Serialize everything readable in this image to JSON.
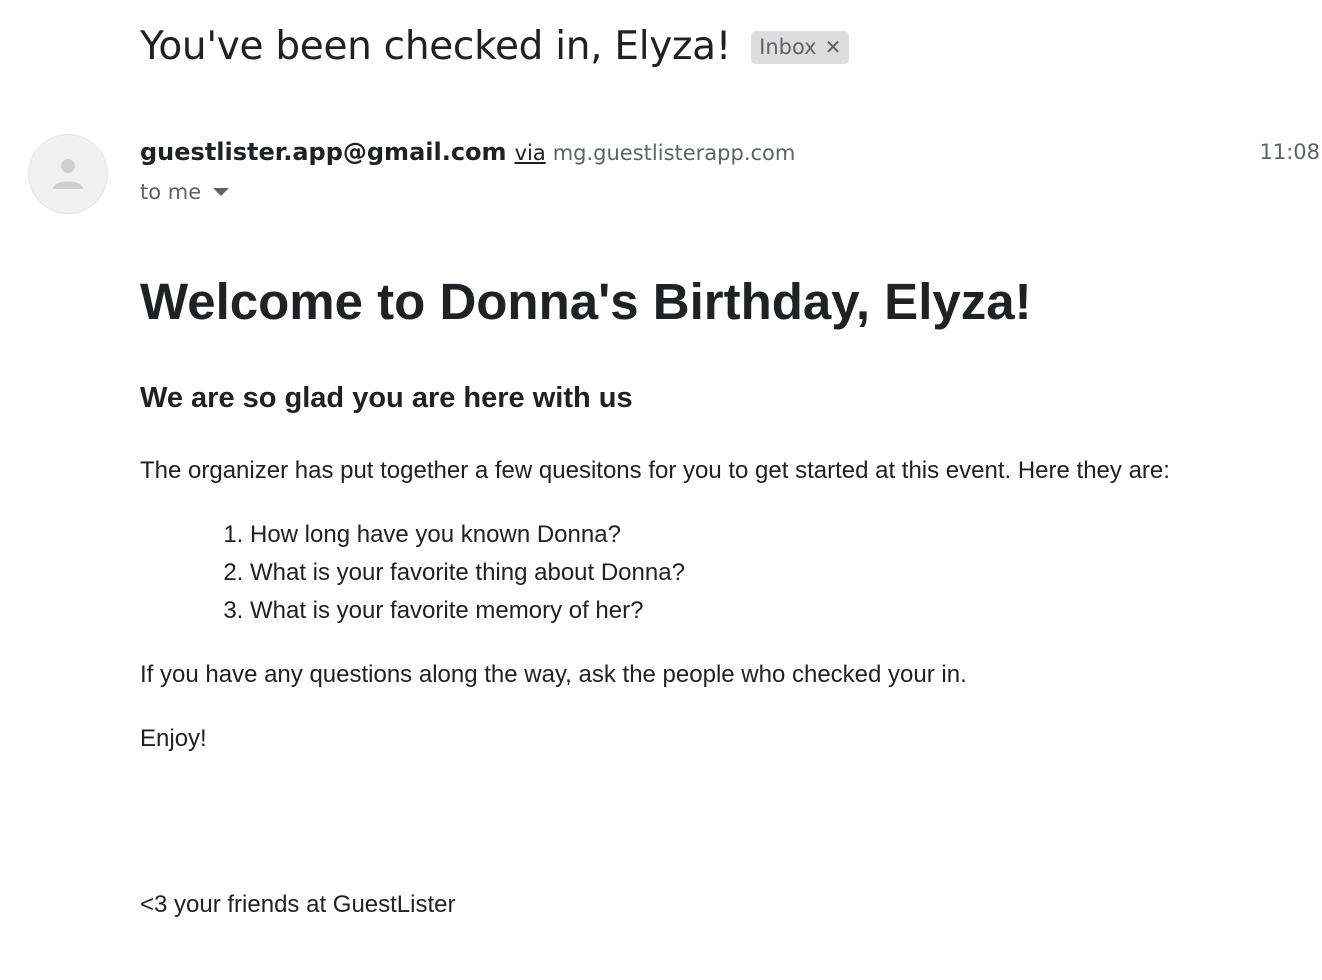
{
  "email": {
    "subject": "You've been checked in, Elyza!",
    "label": "Inbox",
    "label_close_glyph": "✕",
    "sender": {
      "email": "guestlister.app@gmail.com",
      "via_label": "via",
      "via_domain": "mg.guestlisterapp.com",
      "avatar_icon": "person-icon"
    },
    "time": "11:08",
    "recipient": "to me"
  },
  "message": {
    "heading": "Welcome to Donna's Birthday, Elyza!",
    "subheading": "We are so glad you are here with us",
    "intro": "The organizer has put together a few quesitons for you to get started at this event. Here they are:",
    "questions": [
      "How long have you known Donna?",
      "What is your favorite thing about Donna?",
      "What is your favorite memory of her?"
    ],
    "closing": "If you have any questions along the way, ask the people who checked your in.",
    "enjoy": "Enjoy!",
    "signoff": "<3 your friends at GuestLister"
  },
  "colors": {
    "text_primary": "#202124",
    "text_secondary": "#5f6368",
    "chip_background": "#dddddd",
    "avatar_background": "#f1f1f1"
  }
}
